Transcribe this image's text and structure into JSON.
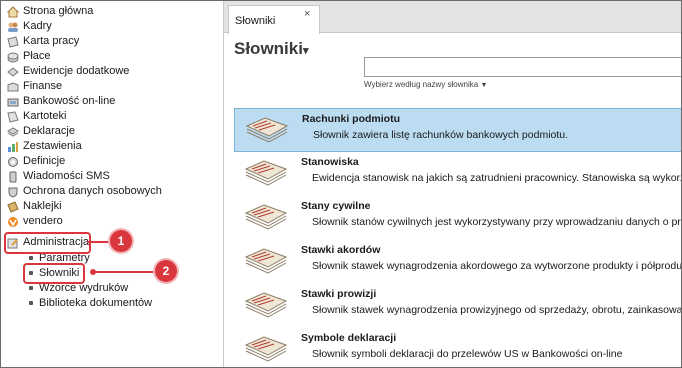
{
  "sidebar": {
    "items": [
      {
        "label": "Strona główna",
        "icon": "home-icon"
      },
      {
        "label": "Kadry",
        "icon": "people-icon"
      },
      {
        "label": "Karta pracy",
        "icon": "card-icon"
      },
      {
        "label": "Płace",
        "icon": "coins-icon"
      },
      {
        "label": "Ewidencje dodatkowe",
        "icon": "records-icon"
      },
      {
        "label": "Finanse",
        "icon": "finance-icon"
      },
      {
        "label": "Bankowość on-line",
        "icon": "bank-icon"
      },
      {
        "label": "Kartoteki",
        "icon": "files-icon"
      },
      {
        "label": "Deklaracje",
        "icon": "declaration-icon"
      },
      {
        "label": "Zestawienia",
        "icon": "chart-icon"
      },
      {
        "label": "Definicje",
        "icon": "definitions-icon"
      },
      {
        "label": "Wiadomości SMS",
        "icon": "sms-icon"
      },
      {
        "label": "Ochrona danych osobowych",
        "icon": "shield-icon"
      },
      {
        "label": "Naklejki",
        "icon": "sticker-icon"
      },
      {
        "label": "vendero",
        "icon": "vendero-icon"
      },
      {
        "label": "Administracja",
        "icon": "admin-icon"
      }
    ],
    "subitems": [
      {
        "label": "Parametry"
      },
      {
        "label": "Słowniki"
      },
      {
        "label": "Wzorce wydruków"
      },
      {
        "label": "Biblioteka dokumentów"
      }
    ]
  },
  "annotations": {
    "callout_1": "1",
    "callout_2": "2",
    "accent": "#d9363e"
  },
  "tab": {
    "label": "Słowniki",
    "close": "×"
  },
  "page": {
    "title": "Słowniki",
    "title_caret": "▾"
  },
  "search": {
    "value": "",
    "hint": "Wybierz według nazwy słownika",
    "hint_caret": "▼"
  },
  "dictionaries": [
    {
      "title": "Rachunki podmiotu",
      "desc": "Słownik zawiera listę rachunków bankowych podmiotu.",
      "selected": true
    },
    {
      "title": "Stanowiska",
      "desc": "Ewidencja stanowisk na jakich są zatrudnieni pracownicy. Stanowiska są wykorzy"
    },
    {
      "title": "Stany cywilne",
      "desc": "Słownik stanów cywilnych jest wykorzystywany przy wprowadzaniu danych o praco"
    },
    {
      "title": "Stawki akordów",
      "desc": "Słownik stawek wynagrodzenia akordowego za wytworzone produkty i półprodu"
    },
    {
      "title": "Stawki prowizji",
      "desc": "Słownik stawek wynagrodzenia prowizyjnego od sprzedaży, obrotu, zainkasowan"
    },
    {
      "title": "Symbole deklaracji",
      "desc": "Słownik symboli deklaracji do przelewów US w Bankowości on-line"
    }
  ]
}
